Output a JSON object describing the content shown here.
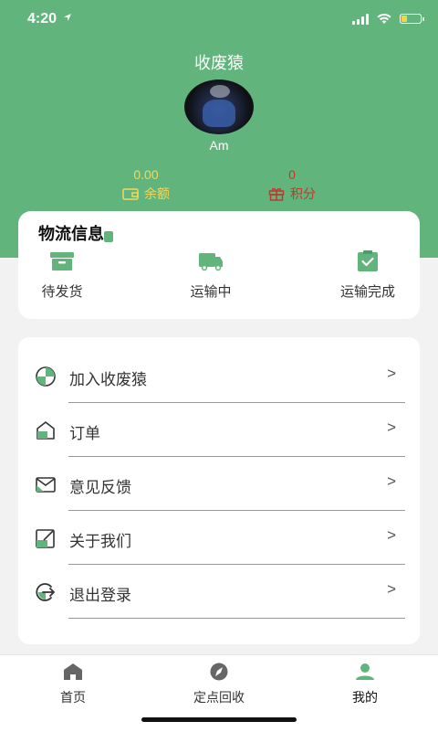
{
  "status_bar": {
    "time": "4:20"
  },
  "header": {
    "title": "收废猿",
    "username": "Am",
    "balance": {
      "value": "0.00",
      "label": "余额",
      "color": "#f2d95c"
    },
    "points": {
      "value": "0",
      "label": "积分",
      "color": "#c0392b"
    }
  },
  "logistics": {
    "title": "物流信息",
    "items": [
      {
        "label": "待发货",
        "icon": "box-icon"
      },
      {
        "label": "运输中",
        "icon": "truck-icon"
      },
      {
        "label": "运输完成",
        "icon": "clipboard-check-icon"
      }
    ]
  },
  "menu": {
    "items": [
      {
        "label": "加入收废猿",
        "icon": "pie-chart-icon"
      },
      {
        "label": "订单",
        "icon": "house-icon"
      },
      {
        "label": "意见反馈",
        "icon": "envelope-icon"
      },
      {
        "label": "关于我们",
        "icon": "edit-box-icon"
      },
      {
        "label": "退出登录",
        "icon": "logout-icon"
      }
    ],
    "chevron": ">"
  },
  "tab_bar": {
    "tabs": [
      {
        "label": "首页",
        "icon": "home-icon"
      },
      {
        "label": "定点回收",
        "icon": "compass-icon"
      },
      {
        "label": "我的",
        "icon": "user-icon",
        "active": true
      }
    ]
  },
  "colors": {
    "brand": "#62b47d",
    "background": "#f2f2f2"
  }
}
